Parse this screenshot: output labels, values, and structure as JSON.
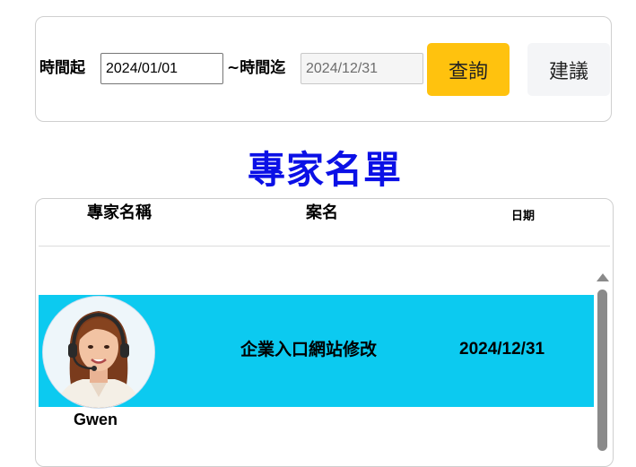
{
  "filter": {
    "start_label": "時間起",
    "start_value": "2024/01/01",
    "end_label": "~時間迄",
    "end_value": "2024/12/31",
    "search_label": "查詢",
    "suggest_label": "建議"
  },
  "page": {
    "title": "專家名單"
  },
  "table": {
    "columns": [
      "專家名稱",
      "案名",
      "日期"
    ],
    "rows": [
      {
        "expert_name": "Gwen",
        "case_name": "企業入口網站修改",
        "date": "2024/12/31"
      }
    ]
  },
  "colors": {
    "title": "#0b10e6",
    "search_button": "#ffc20e",
    "suggest_button": "#f4f5f7",
    "row_highlight": "#0ccaf0"
  },
  "icons": {
    "scroll_up": "scroll-up-arrow-icon",
    "avatar": "expert-avatar-headset"
  }
}
